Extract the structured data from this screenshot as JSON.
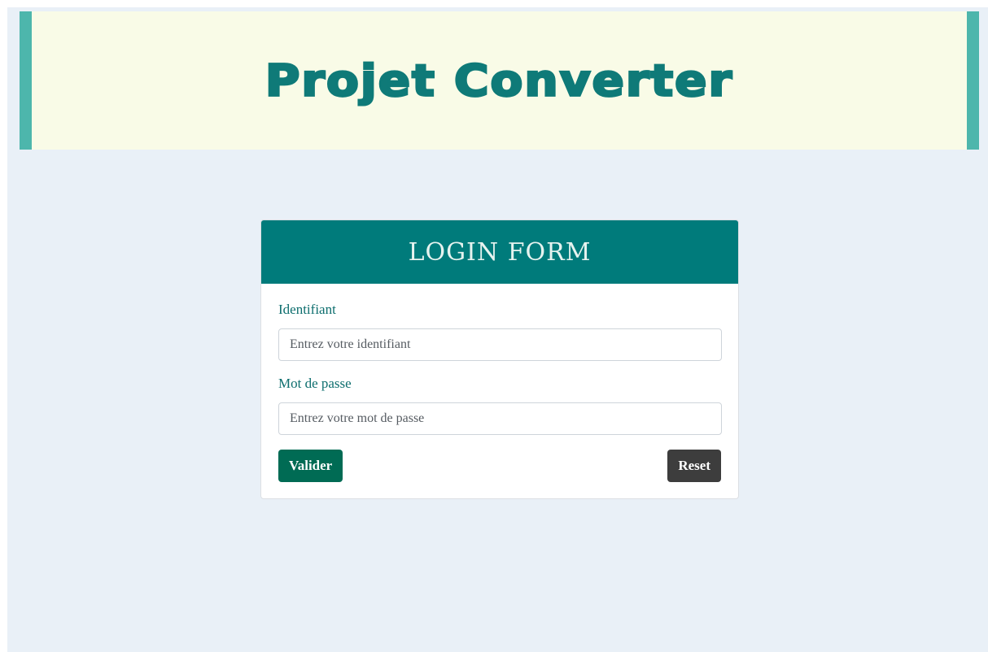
{
  "header": {
    "title": "Projet Converter"
  },
  "login": {
    "title": "LOGIN FORM",
    "identifiant_label": "Identifiant",
    "identifiant_placeholder": "Entrez votre identifiant",
    "identifiant_value": "",
    "password_label": "Mot de passe",
    "password_placeholder": "Entrez votre mot de passe",
    "password_value": "",
    "submit_label": "Valider",
    "reset_label": "Reset"
  },
  "colors": {
    "page_background": "#e9f0f7",
    "banner_background": "#f9fbe7",
    "banner_accent": "#4db6ac",
    "title_color": "#0f7a78",
    "card_header": "#007b7b",
    "submit_button": "#006b54",
    "reset_button": "#3d3d3d"
  }
}
